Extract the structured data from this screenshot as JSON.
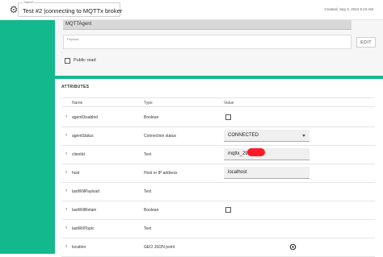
{
  "header": {
    "name_label": "Name*",
    "name_value": "Test #2 |connecting to MQTTx broker",
    "created": "Created: Sep 3, 2024 6:10 AM"
  },
  "top_panel": {
    "agent_field": "MQTTAgent",
    "payload_label": "Payload",
    "edit_label": "EDIT",
    "public_read_label": "Public read",
    "public_read_checked": false
  },
  "attributes": {
    "title": "ATTRIBUTES",
    "columns": [
      "Name",
      "Type",
      "Value"
    ],
    "rows": [
      {
        "name": "agentDisabled",
        "type": "Boolean",
        "value_kind": "checkbox",
        "checked": false
      },
      {
        "name": "agentStatus",
        "type": "Connection status",
        "value_kind": "select",
        "value": "CONNECTED"
      },
      {
        "name": "clientId",
        "type": "Text",
        "value_kind": "text",
        "value": "mqttx_29"
      },
      {
        "name": "host",
        "type": "Host or IP address",
        "value_kind": "text",
        "value": "localhost"
      },
      {
        "name": "lastWillPayload",
        "type": "Text",
        "value_kind": "none"
      },
      {
        "name": "lastWillRetain",
        "type": "Boolean",
        "value_kind": "checkbox",
        "checked": false
      },
      {
        "name": "lastWillTopic",
        "type": "Text",
        "value_kind": "none"
      },
      {
        "name": "location",
        "type": "GEO JSON point",
        "value_kind": "pin"
      }
    ]
  },
  "colors": {
    "accent_green": "#14b88d",
    "redaction": "#ff1a2a"
  }
}
